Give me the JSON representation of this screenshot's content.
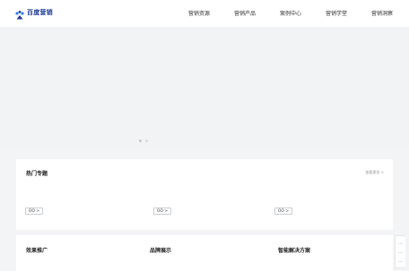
{
  "brand": {
    "logo_text": "百度营销",
    "logo_colors": {
      "primary": "#1f3a93",
      "accent": "#2f80ed"
    }
  },
  "nav": {
    "items": [
      {
        "label": "营销资源"
      },
      {
        "label": "营销产品"
      },
      {
        "label": "案例中心"
      },
      {
        "label": "营销学堂"
      },
      {
        "label": "营销洞察"
      }
    ]
  },
  "hero": {
    "carousel_dots": 2,
    "active_dot": 1
  },
  "hot_topics": {
    "title": "热门专题",
    "more_label": "查看更多 >",
    "chips": [
      "OO >",
      "OO >",
      "OO >"
    ]
  },
  "bottom_tabs": [
    {
      "label": "效果推广"
    },
    {
      "label": "品牌展示"
    },
    {
      "label": "智能解决方案"
    }
  ]
}
